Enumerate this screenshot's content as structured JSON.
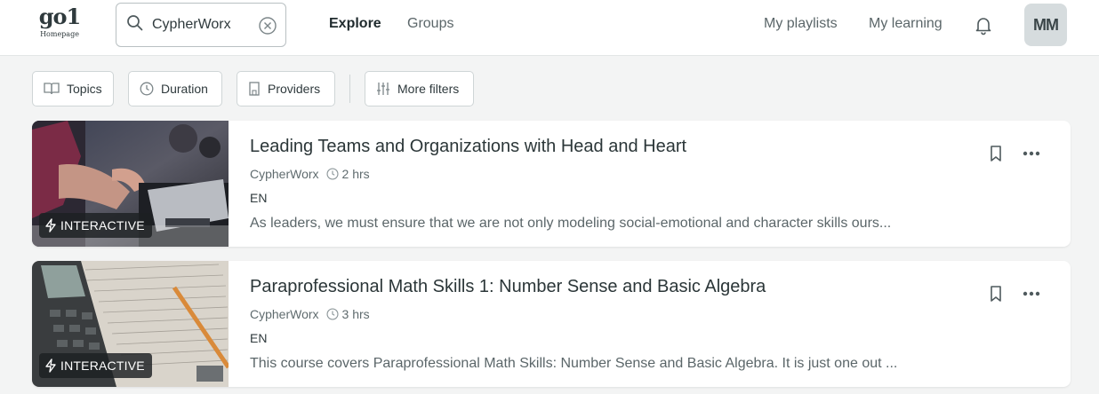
{
  "logo": {
    "mark": "go1",
    "sub": "Homepage"
  },
  "search": {
    "value": "CypherWorx",
    "placeholder": "Search"
  },
  "nav": {
    "explore": "Explore",
    "groups": "Groups",
    "playlists": "My playlists",
    "learning": "My learning"
  },
  "user": {
    "initials": "MM"
  },
  "filters": {
    "topics": "Topics",
    "duration": "Duration",
    "providers": "Providers",
    "more": "More filters"
  },
  "results": [
    {
      "title": "Leading Teams and Organizations with Head and Heart",
      "provider": "CypherWorx",
      "duration": "2 hrs",
      "language": "EN",
      "description": "As leaders, we must ensure that we are not only modeling social-emotional and character skills ours...",
      "badge": "INTERACTIVE",
      "thumb_icon": "meeting-photo"
    },
    {
      "title": "Paraprofessional Math Skills 1: Number Sense and Basic Algebra",
      "provider": "CypherWorx",
      "duration": "3 hrs",
      "language": "EN",
      "description": "This course covers Paraprofessional Math Skills: Number Sense and Basic Algebra. It is just one out ...",
      "badge": "INTERACTIVE",
      "thumb_icon": "calculator-photo"
    }
  ],
  "colors": {
    "text": "#2f3a3d",
    "muted": "#5b6669",
    "page_bg": "#f3f4f4",
    "border": "#cfd5d6"
  }
}
